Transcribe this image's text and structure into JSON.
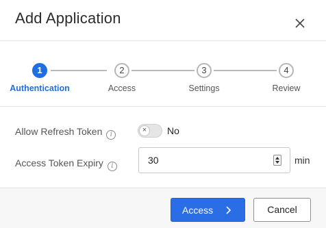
{
  "dialog": {
    "title": "Add Application",
    "close_icon": "close-icon"
  },
  "stepper": {
    "active_index": 0,
    "steps": [
      {
        "number": "1",
        "label": "Authentication"
      },
      {
        "number": "2",
        "label": "Access"
      },
      {
        "number": "3",
        "label": "Settings"
      },
      {
        "number": "4",
        "label": "Review"
      }
    ]
  },
  "form": {
    "refresh_token": {
      "label": "Allow Refresh Token",
      "info_icon": "info-icon",
      "toggle_state": "No",
      "toggle_icon": "x-icon"
    },
    "token_expiry": {
      "label": "Access Token Expiry",
      "info_icon": "info-icon",
      "value": "30",
      "unit": "min"
    }
  },
  "footer": {
    "next_label": "Access",
    "next_icon": "chevron-right-icon",
    "cancel_label": "Cancel"
  },
  "colors": {
    "accent": "#1f6fe0",
    "primary_button": "#2a6ee6"
  }
}
